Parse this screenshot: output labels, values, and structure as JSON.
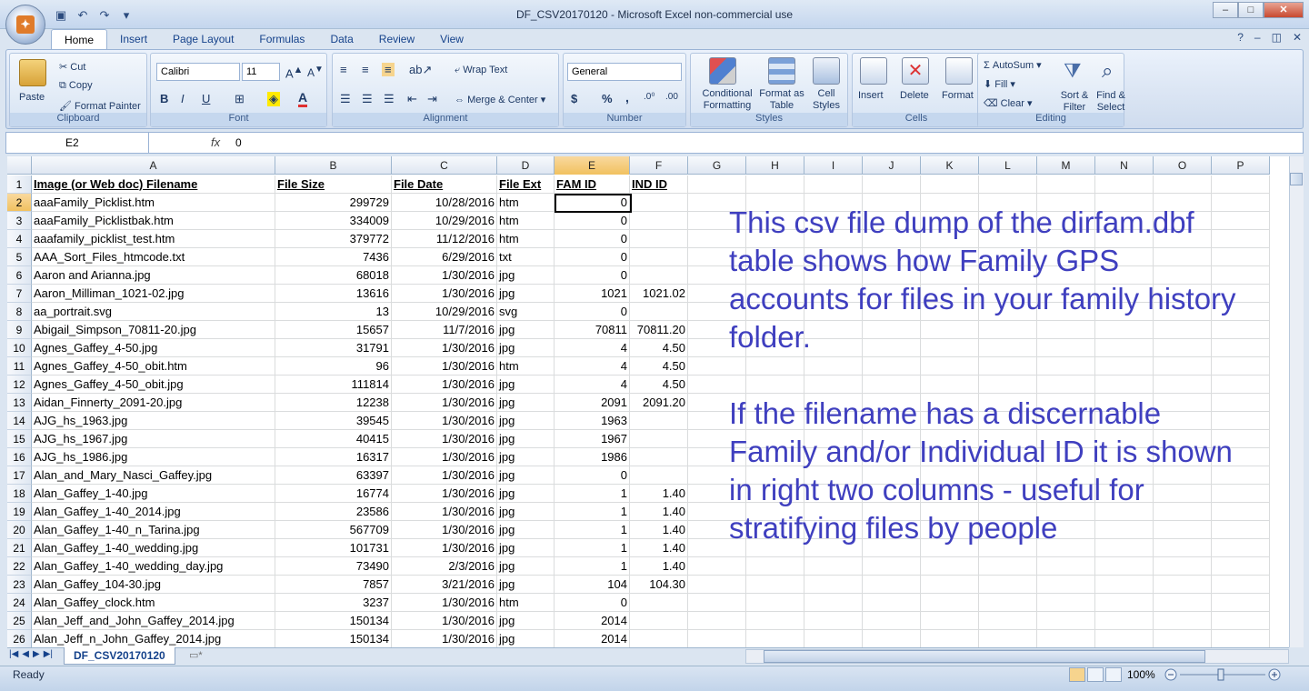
{
  "window": {
    "title": "DF_CSV20170120  -  Microsoft Excel non-commercial use"
  },
  "ribbon_tabs": [
    "Home",
    "Insert",
    "Page Layout",
    "Formulas",
    "Data",
    "Review",
    "View"
  ],
  "clipboard": {
    "paste": "Paste",
    "cut": "Cut",
    "copy": "Copy",
    "format_painter": "Format Painter",
    "label": "Clipboard"
  },
  "font": {
    "name": "Calibri",
    "size": "11",
    "label": "Font"
  },
  "alignment": {
    "wrap": "Wrap Text",
    "merge": "Merge & Center",
    "label": "Alignment"
  },
  "number": {
    "format": "General",
    "label": "Number",
    "currency": "$",
    "percent": "%",
    "comma": ","
  },
  "styles": {
    "conditional": "Conditional Formatting",
    "format_table": "Format as Table",
    "cell_styles": "Cell Styles",
    "label": "Styles"
  },
  "cells": {
    "insert": "Insert",
    "delete": "Delete",
    "format": "Format",
    "label": "Cells"
  },
  "editing": {
    "autosum": "AutoSum",
    "fill": "Fill",
    "clear": "Clear",
    "sort": "Sort & Filter",
    "find": "Find & Select",
    "label": "Editing"
  },
  "formula_bar": {
    "name_box": "E2",
    "fx": "fx",
    "content": "0"
  },
  "columns": [
    "A",
    "B",
    "C",
    "D",
    "E",
    "F",
    "G",
    "H",
    "I",
    "J",
    "K",
    "L",
    "M",
    "N",
    "O",
    "P"
  ],
  "header_row": [
    "Image (or Web doc) Filename",
    "File Size",
    "File Date",
    "File Ext",
    "FAM ID",
    "IND ID"
  ],
  "rows": [
    [
      "aaaFamily_Picklist.htm",
      "299729",
      "10/28/2016",
      "htm",
      "0",
      ""
    ],
    [
      "aaaFamily_Picklistbak.htm",
      "334009",
      "10/29/2016",
      "htm",
      "0",
      ""
    ],
    [
      "aaafamily_picklist_test.htm",
      "379772",
      "11/12/2016",
      "htm",
      "0",
      ""
    ],
    [
      "AAA_Sort_Files_htmcode.txt",
      "7436",
      "6/29/2016",
      "txt",
      "0",
      ""
    ],
    [
      "Aaron and Arianna.jpg",
      "68018",
      "1/30/2016",
      "jpg",
      "0",
      ""
    ],
    [
      "Aaron_Milliman_1021-02.jpg",
      "13616",
      "1/30/2016",
      "jpg",
      "1021",
      "1021.02"
    ],
    [
      "aa_portrait.svg",
      "13",
      "10/29/2016",
      "svg",
      "0",
      ""
    ],
    [
      "Abigail_Simpson_70811-20.jpg",
      "15657",
      "11/7/2016",
      "jpg",
      "70811",
      "70811.20"
    ],
    [
      "Agnes_Gaffey_4-50.jpg",
      "31791",
      "1/30/2016",
      "jpg",
      "4",
      "4.50"
    ],
    [
      "Agnes_Gaffey_4-50_obit.htm",
      "96",
      "1/30/2016",
      "htm",
      "4",
      "4.50"
    ],
    [
      "Agnes_Gaffey_4-50_obit.jpg",
      "111814",
      "1/30/2016",
      "jpg",
      "4",
      "4.50"
    ],
    [
      "Aidan_Finnerty_2091-20.jpg",
      "12238",
      "1/30/2016",
      "jpg",
      "2091",
      "2091.20"
    ],
    [
      "AJG_hs_1963.jpg",
      "39545",
      "1/30/2016",
      "jpg",
      "1963",
      ""
    ],
    [
      "AJG_hs_1967.jpg",
      "40415",
      "1/30/2016",
      "jpg",
      "1967",
      ""
    ],
    [
      "AJG_hs_1986.jpg",
      "16317",
      "1/30/2016",
      "jpg",
      "1986",
      ""
    ],
    [
      "Alan_and_Mary_Nasci_Gaffey.jpg",
      "63397",
      "1/30/2016",
      "jpg",
      "0",
      ""
    ],
    [
      "Alan_Gaffey_1-40.jpg",
      "16774",
      "1/30/2016",
      "jpg",
      "1",
      "1.40"
    ],
    [
      "Alan_Gaffey_1-40_2014.jpg",
      "23586",
      "1/30/2016",
      "jpg",
      "1",
      "1.40"
    ],
    [
      "Alan_Gaffey_1-40_n_Tarina.jpg",
      "567709",
      "1/30/2016",
      "jpg",
      "1",
      "1.40"
    ],
    [
      "Alan_Gaffey_1-40_wedding.jpg",
      "101731",
      "1/30/2016",
      "jpg",
      "1",
      "1.40"
    ],
    [
      "Alan_Gaffey_1-40_wedding_day.jpg",
      "73490",
      "2/3/2016",
      "jpg",
      "1",
      "1.40"
    ],
    [
      "Alan_Gaffey_104-30.jpg",
      "7857",
      "3/21/2016",
      "jpg",
      "104",
      "104.30"
    ],
    [
      "Alan_Gaffey_clock.htm",
      "3237",
      "1/30/2016",
      "htm",
      "0",
      ""
    ],
    [
      "Alan_Jeff_and_John_Gaffey_2014.jpg",
      "150134",
      "1/30/2016",
      "jpg",
      "2014",
      ""
    ],
    [
      "Alan_Jeff_n_John_Gaffey_2014.jpg",
      "150134",
      "1/30/2016",
      "jpg",
      "2014",
      ""
    ]
  ],
  "note": {
    "para1": "This csv file dump of the dirfam.dbf table shows how Family GPS accounts for files in your family history folder.",
    "para2": "If the filename has a discernable Family and/or Individual ID it is shown in right two columns - useful for stratifying files by people"
  },
  "sheet_tab": "DF_CSV20170120",
  "status": {
    "text": "Ready",
    "zoom": "100%"
  },
  "colors": {
    "note": "#3f3fbf",
    "selection": "#f1c15f",
    "ribbon": "#dbe5f1"
  }
}
